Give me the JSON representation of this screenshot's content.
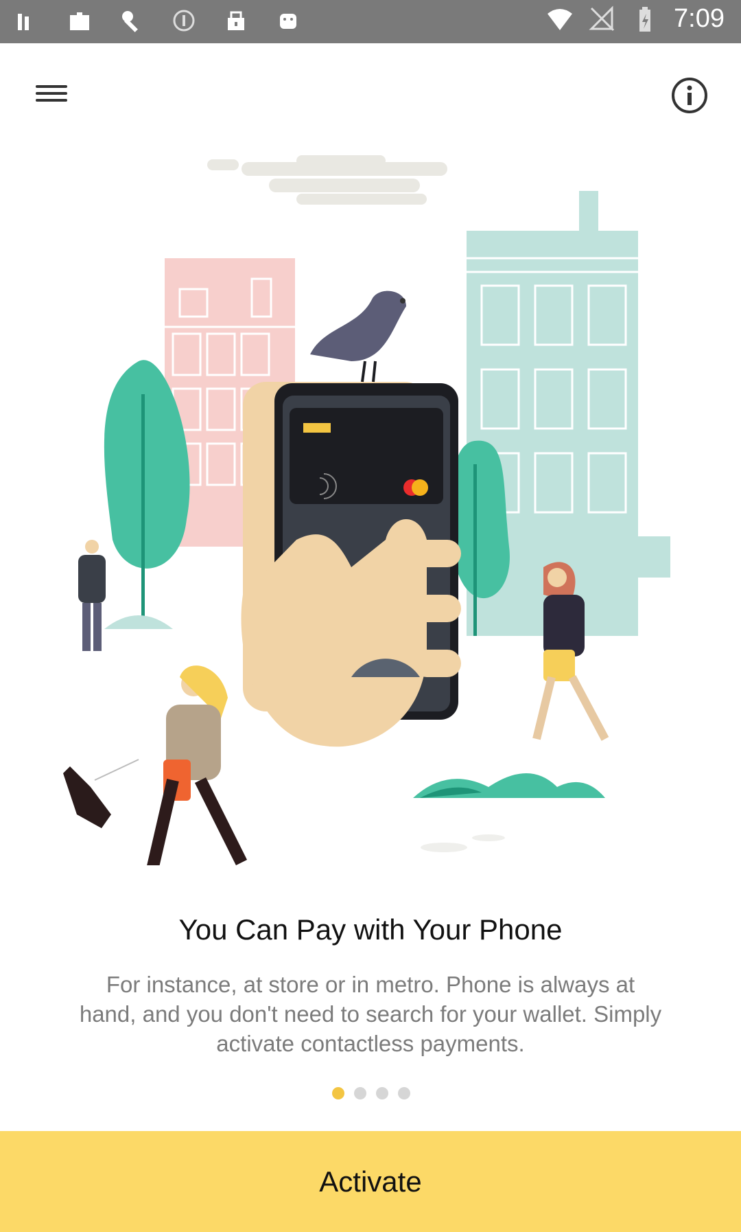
{
  "status_bar": {
    "time": "7:09",
    "left_icons": [
      "notification-icon",
      "notification-icon",
      "wrench-icon",
      "circle-icon",
      "lock-icon",
      "android-icon"
    ],
    "right_icons": [
      "wifi-icon",
      "no-signal-icon",
      "battery-icon"
    ]
  },
  "app_bar": {
    "menu_icon": "hamburger-icon",
    "info_icon": "info-icon"
  },
  "onboarding": {
    "title": "You Can Pay with Your Phone",
    "description": "For instance, at store or in metro. Phone is always at hand, and you don't need to search for your wallet. Simply activate contactless payments.",
    "page_indicator": {
      "total": 4,
      "current": 1
    }
  },
  "action": {
    "activate_label": "Activate"
  },
  "colors": {
    "accent": "#fcd967",
    "indicator_active": "#f3c542",
    "status_bar": "#7a7a7a",
    "pink_building": "#f5c9c6",
    "mint_building": "#bfe2dc",
    "tree_green": "#47c0a1"
  }
}
